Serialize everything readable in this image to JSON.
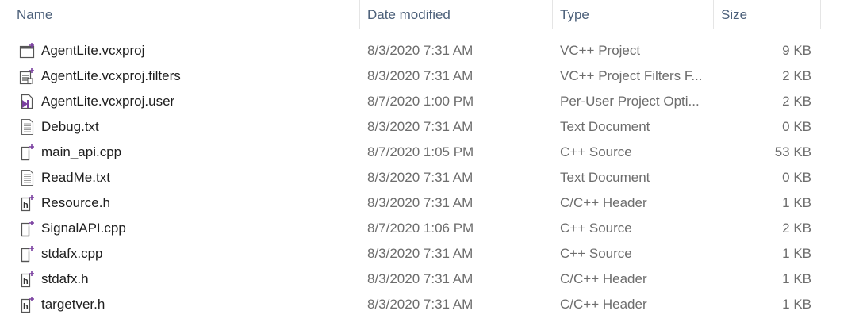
{
  "columns": {
    "name": "Name",
    "date": "Date modified",
    "type": "Type",
    "size": "Size"
  },
  "files": [
    {
      "name": "AgentLite.vcxproj",
      "date": "8/3/2020 7:31 AM",
      "type": "VC++ Project",
      "size": "9 KB",
      "icon": "vcxproj-icon"
    },
    {
      "name": "AgentLite.vcxproj.filters",
      "date": "8/3/2020 7:31 AM",
      "type": "VC++ Project Filters F...",
      "size": "2 KB",
      "icon": "filters-icon"
    },
    {
      "name": "AgentLite.vcxproj.user",
      "date": "8/7/2020 1:00 PM",
      "type": "Per-User Project Opti...",
      "size": "2 KB",
      "icon": "user-file-icon"
    },
    {
      "name": "Debug.txt",
      "date": "8/3/2020 7:31 AM",
      "type": "Text Document",
      "size": "0 KB",
      "icon": "text-file-icon"
    },
    {
      "name": "main_api.cpp",
      "date": "8/7/2020 1:05 PM",
      "type": "C++ Source",
      "size": "53 KB",
      "icon": "cpp-file-icon"
    },
    {
      "name": "ReadMe.txt",
      "date": "8/3/2020 7:31 AM",
      "type": "Text Document",
      "size": "0 KB",
      "icon": "text-file-icon"
    },
    {
      "name": "Resource.h",
      "date": "8/3/2020 7:31 AM",
      "type": "C/C++ Header",
      "size": "1 KB",
      "icon": "header-file-icon"
    },
    {
      "name": "SignalAPI.cpp",
      "date": "8/7/2020 1:06 PM",
      "type": "C++ Source",
      "size": "2 KB",
      "icon": "cpp-file-icon"
    },
    {
      "name": "stdafx.cpp",
      "date": "8/3/2020 7:31 AM",
      "type": "C++ Source",
      "size": "1 KB",
      "icon": "cpp-file-icon"
    },
    {
      "name": "stdafx.h",
      "date": "8/3/2020 7:31 AM",
      "type": "C/C++ Header",
      "size": "1 KB",
      "icon": "header-file-icon"
    },
    {
      "name": "targetver.h",
      "date": "8/3/2020 7:31 AM",
      "type": "C/C++ Header",
      "size": "1 KB",
      "icon": "header-file-icon"
    }
  ],
  "colors": {
    "header_text": "#4c607a",
    "secondary_text": "#6d6d6d",
    "accent_purple": "#7a3fa0"
  }
}
